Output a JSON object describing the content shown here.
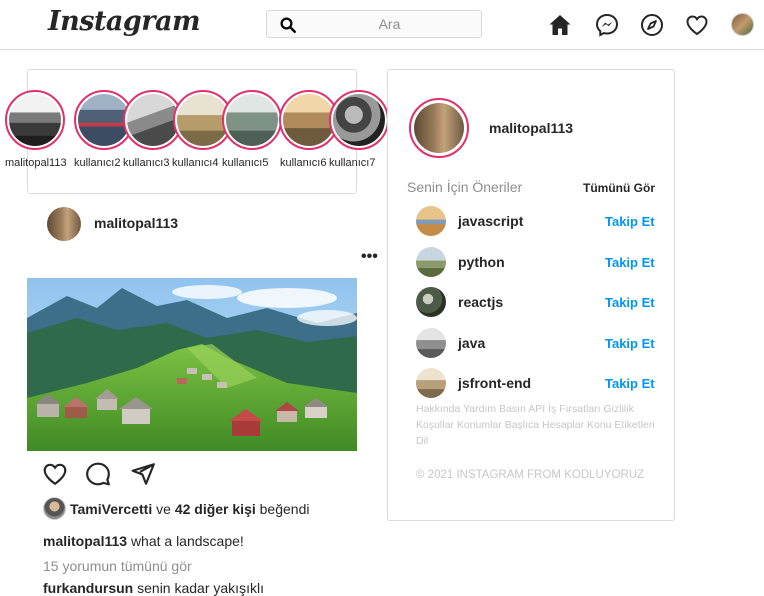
{
  "header": {
    "logo": "Instagram",
    "search_placeholder": "Ara"
  },
  "stories": [
    {
      "label": "malitopal113"
    },
    {
      "label": "kullanıcı2"
    },
    {
      "label": "kullanıcı3"
    },
    {
      "label": "kullanıcı4"
    },
    {
      "label": "kullanıcı5"
    },
    {
      "label": "kullanıcı6"
    },
    {
      "label": "kullanıcı7"
    }
  ],
  "post": {
    "username": "malitopal113",
    "more": "•••",
    "liked_by": "TamiVercetti",
    "likes_and": "ve",
    "likes_others": "42 diğer kişi",
    "likes_suffix": "beğendi",
    "caption_user": "malitopal113",
    "caption_text": "what a landscape!",
    "view_comments": "15 yorumun tümünü gör",
    "comment_user": "furkandursun",
    "comment_text": "senin kadar yakışıklı"
  },
  "sidebar": {
    "profile_name": "malitopal113",
    "suggestions_title": "Senin İçin Öneriler",
    "see_all": "Tümünü Gör",
    "suggestions": [
      {
        "name": "javascript",
        "follow": "Takip Et"
      },
      {
        "name": "python",
        "follow": "Takip Et"
      },
      {
        "name": "reactjs",
        "follow": "Takip Et"
      },
      {
        "name": "java",
        "follow": "Takip Et"
      },
      {
        "name": "jsfront-end",
        "follow": "Takip Et"
      }
    ],
    "footer_links": "Hakkında Yardım Basın API İş Fırsatları Gizlilik Koşullar Konumlar Başlıca Hesaplar Konu Etiketleri Dil",
    "copyright": "© 2021 INSTAGRAM FROM KODLUYORUZ"
  },
  "colors": {
    "story_ring": "#e1306c",
    "link_blue": "#0095f6",
    "border": "#dbdbdb"
  }
}
